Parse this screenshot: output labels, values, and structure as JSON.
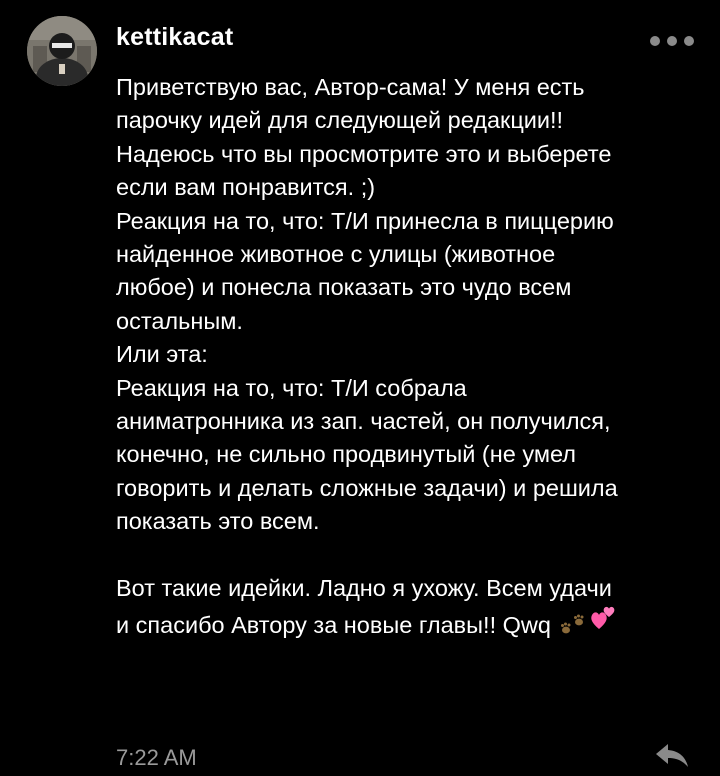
{
  "post": {
    "username": "kettikacat",
    "more_icon": "more-horizontal-icon",
    "reply_icon": "reply-icon",
    "timestamp": "7:22 AM",
    "message_lines": [
      "Приветствую вас, Автор-сама! У меня есть",
      "парочку идей для следующей редакции!!",
      "Надеюсь что вы просмотрите это и выберете",
      "если вам понравится. ;)",
      "Реакция на то, что: Т/И принесла в пиццерию",
      "найденное животное с улицы (животное",
      "любое) и понесла показать это чудо всем",
      "остальным.",
      "Или эта:",
      "Реакция на то, что: Т/И собрала",
      "аниматронника из зап. частей, он получился,",
      "конечно, не сильно продвинутый (не умел",
      "говорить и делать сложные задачи) и решила",
      "показать это всем.",
      "",
      "Вот такие идейки. Ладно я ухожу. Всем удачи",
      "и спасибо Автору за новые главы!! Qwq"
    ],
    "trailing_emoji": [
      "paw-prints-emoji",
      "two-hearts-emoji"
    ],
    "colors": {
      "background": "#000000",
      "text": "#ffffff",
      "muted": "#9a9a9a",
      "icon": "#8a8a8a"
    }
  }
}
